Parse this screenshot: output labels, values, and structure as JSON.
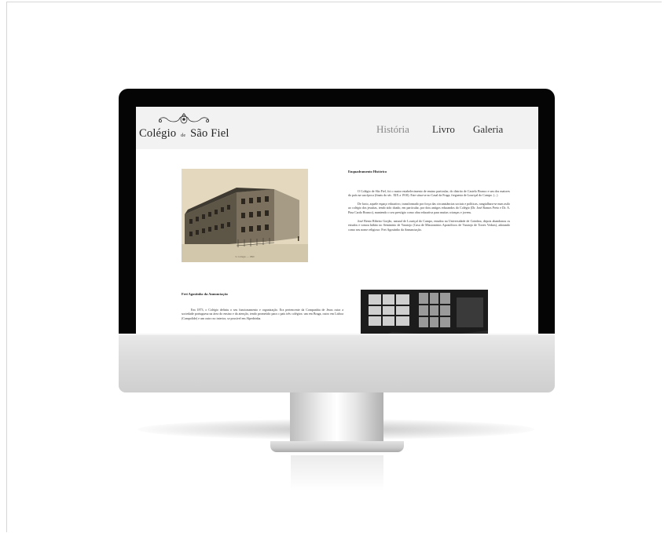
{
  "site": {
    "logo_main": "Colégio",
    "logo_small": "de",
    "logo_end": "São Fiel"
  },
  "nav": {
    "items": [
      "História",
      "Livro",
      "Galeria"
    ]
  },
  "section1": {
    "title": "Enquadramento Histórico",
    "paragraphs": [
      "O Colégio de São Fiel, foi o maior estabelecimento de ensino particular, do distrito de Castelo Branco e um dos maiores do país na sua época (finais do séc. XIX a 1910). Este situa-se no Casal da Fraga, freguesia de Louriçal do Campo. (...)",
      "De facto, aquele espaço educativo, transformado por força das circunstâncias sociais e políticas, rangialhara-se num asilo ao colégio dos jesuítas, tendo sido doado, em particular, por dois antigos educandos do Colégio (Dr. José Ramos Preto e Dr. A. Pina Cardo Branco), mantendo o seu prestígio como obra educativa para muitas crianças e jovens.",
      "José Bento Ribeiro Gorjão, natural de Louriçal do Campo, estudou na Universidade de Coimbra, depois abandonou os estudos e tomou hábito no Seminário de Varatojo (Casa de Missionários Apostólicos de Varatojo de Torres Vedras), adotando como seu nome religioso: Frei Agostinho da Annunciação."
    ],
    "photo_caption": "S. Collegio — 1890"
  },
  "section2": {
    "title": "Frei Agostinho da Annunciação",
    "paragraphs": [
      "Em 1873, o Colégio definiu o seu funcionamento e organização. Era pertencente da Companhia de Jesus ostra a sociedade portuguesa na área do ensino e da atenção, tendo prometido para o país três colégios: um em Braga, outro em Lisboa (Campolide) e um outro no interior, se possível em Alpedrinha."
    ]
  }
}
